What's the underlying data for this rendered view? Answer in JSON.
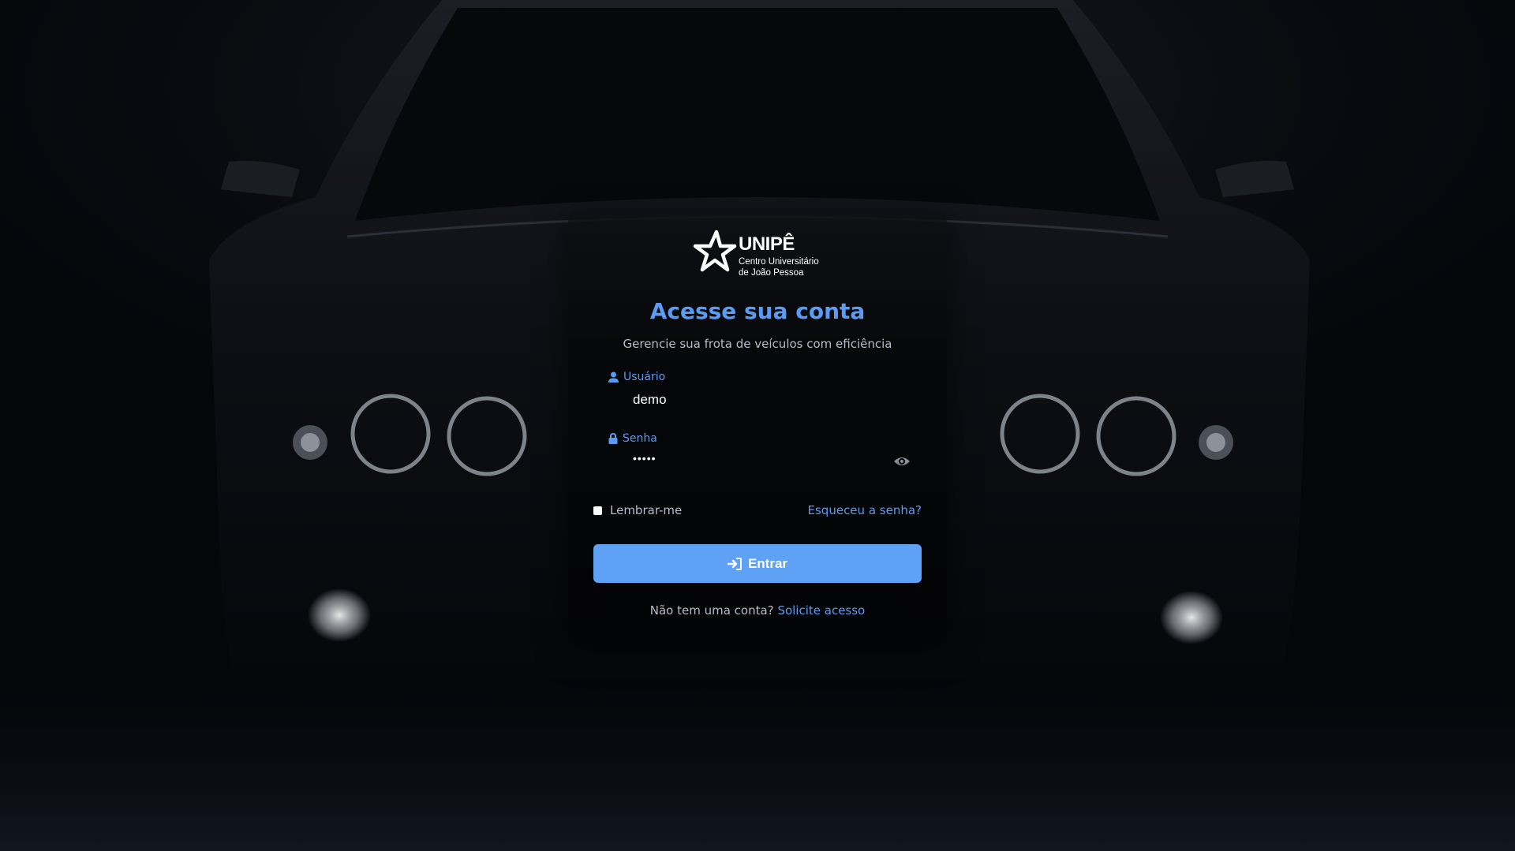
{
  "brand": {
    "name": "UNIPÊ",
    "subtitle_line1": "Centro Universitário",
    "subtitle_line2": "de João Pessoa"
  },
  "login": {
    "title": "Acesse sua conta",
    "subtitle": "Gerencie sua frota de veículos com eficiência",
    "username_label": "Usuário",
    "username_value": "demo",
    "password_label": "Senha",
    "password_mask": "•••••",
    "remember_label": "Lembrar-me",
    "remember_checked": false,
    "forgot_link": "Esqueceu a senha?",
    "submit_label": "Entrar",
    "signup_prompt": "Não tem uma conta?",
    "signup_link": "Solicite acesso"
  },
  "icons": {
    "username": "user-icon",
    "password": "lock-icon",
    "toggle_password": "eye-icon",
    "submit": "sign-in-icon"
  },
  "colors": {
    "accent": "#5b9cf2",
    "button": "#5ea1f5",
    "muted_text": "#b8bcc6",
    "card_bg": "#050608"
  }
}
